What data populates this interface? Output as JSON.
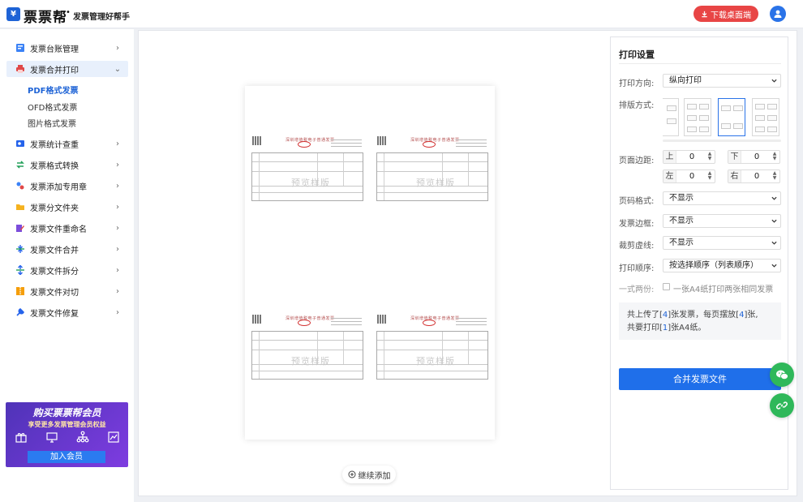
{
  "header": {
    "logo_mark": "¥",
    "brand": "票票帮",
    "separator": "•",
    "slogan": "发票管理好帮手",
    "download_label": "下载桌面端"
  },
  "sidebar": {
    "items": [
      {
        "label": "发票台账管理",
        "icon": "ledger-icon"
      },
      {
        "label": "发票合并打印",
        "icon": "printer-icon"
      },
      {
        "label": "发票统计查重",
        "icon": "statistics-icon"
      },
      {
        "label": "发票格式转换",
        "icon": "convert-icon"
      },
      {
        "label": "发票添加专用章",
        "icon": "stamp-icon"
      },
      {
        "label": "发票分文件夹",
        "icon": "folder-icon"
      },
      {
        "label": "发票文件重命名",
        "icon": "rename-icon"
      },
      {
        "label": "发票文件合并",
        "icon": "merge-icon"
      },
      {
        "label": "发票文件拆分",
        "icon": "split-icon"
      },
      {
        "label": "发票文件对切",
        "icon": "cut-icon"
      },
      {
        "label": "发票文件修复",
        "icon": "repair-icon"
      }
    ],
    "sub_items": [
      "PDF格式发票",
      "OFD格式发票",
      "图片格式发票"
    ],
    "promo": {
      "title": "购买票票帮会员",
      "subtitle": "享受更多发票管理会员权益",
      "button": "加入会员"
    }
  },
  "preview": {
    "invoice_title": "深圳增值税电子普通发票",
    "watermark": "预览样版",
    "continue_label": "继续添加"
  },
  "settings": {
    "title": "打印设置",
    "orientation": {
      "label": "打印方向:",
      "value": "纵向打印"
    },
    "layout": {
      "label": "排版方式:"
    },
    "margins": {
      "label": "页面边距:",
      "top": {
        "label": "上",
        "value": "0"
      },
      "bottom": {
        "label": "下",
        "value": "0"
      },
      "left": {
        "label": "左",
        "value": "0"
      },
      "right": {
        "label": "右",
        "value": "0"
      }
    },
    "page_number": {
      "label": "页码格式:",
      "value": "不显示"
    },
    "invoice_border": {
      "label": "发票边框:",
      "value": "不显示"
    },
    "cut_line": {
      "label": "裁剪虚线:",
      "value": "不显示"
    },
    "print_order": {
      "label": "打印顺序:",
      "value": "按选择顺序（列表顺序）"
    },
    "duplicate": {
      "label": "一式两份:",
      "checkbox_label": "一张A4纸打印两张相同发票"
    },
    "summary": {
      "p1": "共上传了[",
      "uploaded": "4",
      "p2": "]张发票，每页摆放[",
      "per_page": "4",
      "p3": "]张,",
      "p4": "共要打印[",
      "sheets": "1",
      "p5": "]张A4纸。"
    },
    "merge_button": "合并发票文件"
  },
  "colors": {
    "accent": "#1f6fea",
    "download": "#e84545",
    "float_green": "#2fb85a"
  }
}
